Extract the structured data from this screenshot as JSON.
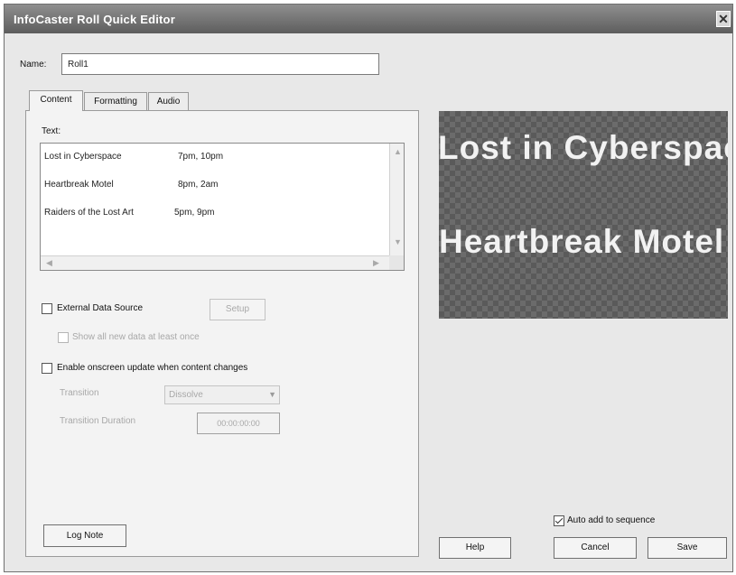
{
  "window": {
    "title": "InfoCaster Roll Quick Editor",
    "close_glyph": "✕"
  },
  "name": {
    "label": "Name:",
    "value": "Roll1"
  },
  "tabs": [
    {
      "label": "Content",
      "active": true
    },
    {
      "label": "Formatting",
      "active": false
    },
    {
      "label": "Audio",
      "active": false
    }
  ],
  "content": {
    "text_label": "Text:",
    "rows": [
      {
        "title": "Lost in Cyberspace",
        "times": "7pm, 10pm"
      },
      {
        "title": "Heartbreak Motel",
        "times": "8pm, 2am"
      },
      {
        "title": "Raiders of the Lost Art",
        "times": "5pm, 9pm"
      }
    ],
    "external_data_source": {
      "label": "External Data Source",
      "checked": false
    },
    "setup_button": "Setup",
    "show_all_new_data": {
      "label": "Show all new data at least once",
      "checked": false
    },
    "enable_onscreen_update": {
      "label": "Enable onscreen update when content changes",
      "checked": false
    },
    "transition": {
      "label": "Transition",
      "value": "Dissolve"
    },
    "transition_duration": {
      "label": "Transition Duration",
      "value": "00:00:00:00"
    },
    "log_note_button": "Log Note"
  },
  "preview": {
    "lines": [
      "Lost in Cyberspace",
      "Heartbreak Motel"
    ],
    "colors": {
      "text": "#f2f2f2",
      "checker_dark": "#5a5a5a",
      "checker_light": "#6b6b6b"
    }
  },
  "footer": {
    "auto_add": {
      "label": "Auto add to sequence",
      "checked": true
    },
    "help_button": "Help",
    "cancel_button": "Cancel",
    "save_button": "Save"
  }
}
